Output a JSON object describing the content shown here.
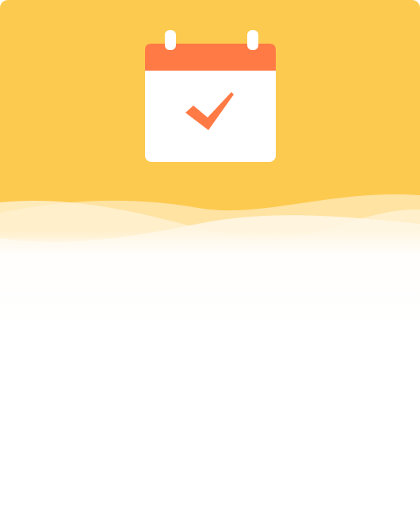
{
  "dialog": {
    "icon": "calendar-check-icon",
    "colors": {
      "header": "#FDCA50",
      "calendar_top": "#FF7A45",
      "calendar_body": "#FFFFFF",
      "check": "#FF7A45",
      "background": "#FFFFFF"
    }
  }
}
